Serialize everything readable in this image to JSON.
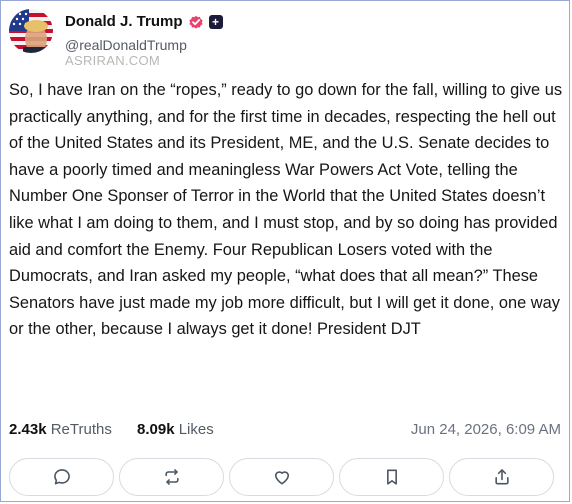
{
  "post": {
    "author": {
      "name": "Donald J. Trump",
      "handle": "@realDonaldTrump",
      "verified_color": "#e8436d",
      "plus_badge": "+",
      "plus_badge_color": "#1b1b3a"
    },
    "watermark": "ASRIRAN.COM",
    "text": "So, I have Iran on the “ropes,” ready to go down for the fall, willing to give us practically anything, and for the first time in decades, respecting the hell out of the United States and its President, ME, and the U.S. Senate decides to have a poorly timed and meaningless War Powers Act Vote, telling the Number One Sponser of Terror in the World that the United States doesn’t like what I am doing to them, and I must stop, and by so doing has provided aid and comfort the Enemy. Four Republican Losers voted with the Dumocrats, and Iran asked my people, “what does that all mean?” These Senators have just made my job more difficult, but I will get it done, one way or the other, because I always get it done! President DJT",
    "stats": {
      "retruths_count": "2.43k",
      "retruths_label": "ReTruths",
      "likes_count": "8.09k",
      "likes_label": "Likes"
    },
    "timestamp": "Jun 24, 2026, 6:09 AM"
  },
  "actions": {
    "icons": [
      "reply-icon",
      "retruth-icon",
      "like-icon",
      "bookmark-icon",
      "share-icon"
    ]
  },
  "colors": {
    "border": "#9aa7d6",
    "icon": "#4b5563",
    "text_muted": "#555b66"
  }
}
